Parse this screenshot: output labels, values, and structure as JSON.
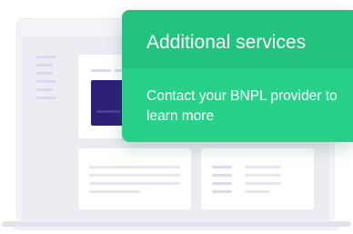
{
  "popup": {
    "title": "Additional services",
    "message": "Contact your BNPL provider to learn more"
  },
  "colors": {
    "accent_green": "#22c27f",
    "accent_green_light": "#29d08a",
    "product_image": "#2d1f78",
    "placeholder": "#d9d9ef"
  }
}
